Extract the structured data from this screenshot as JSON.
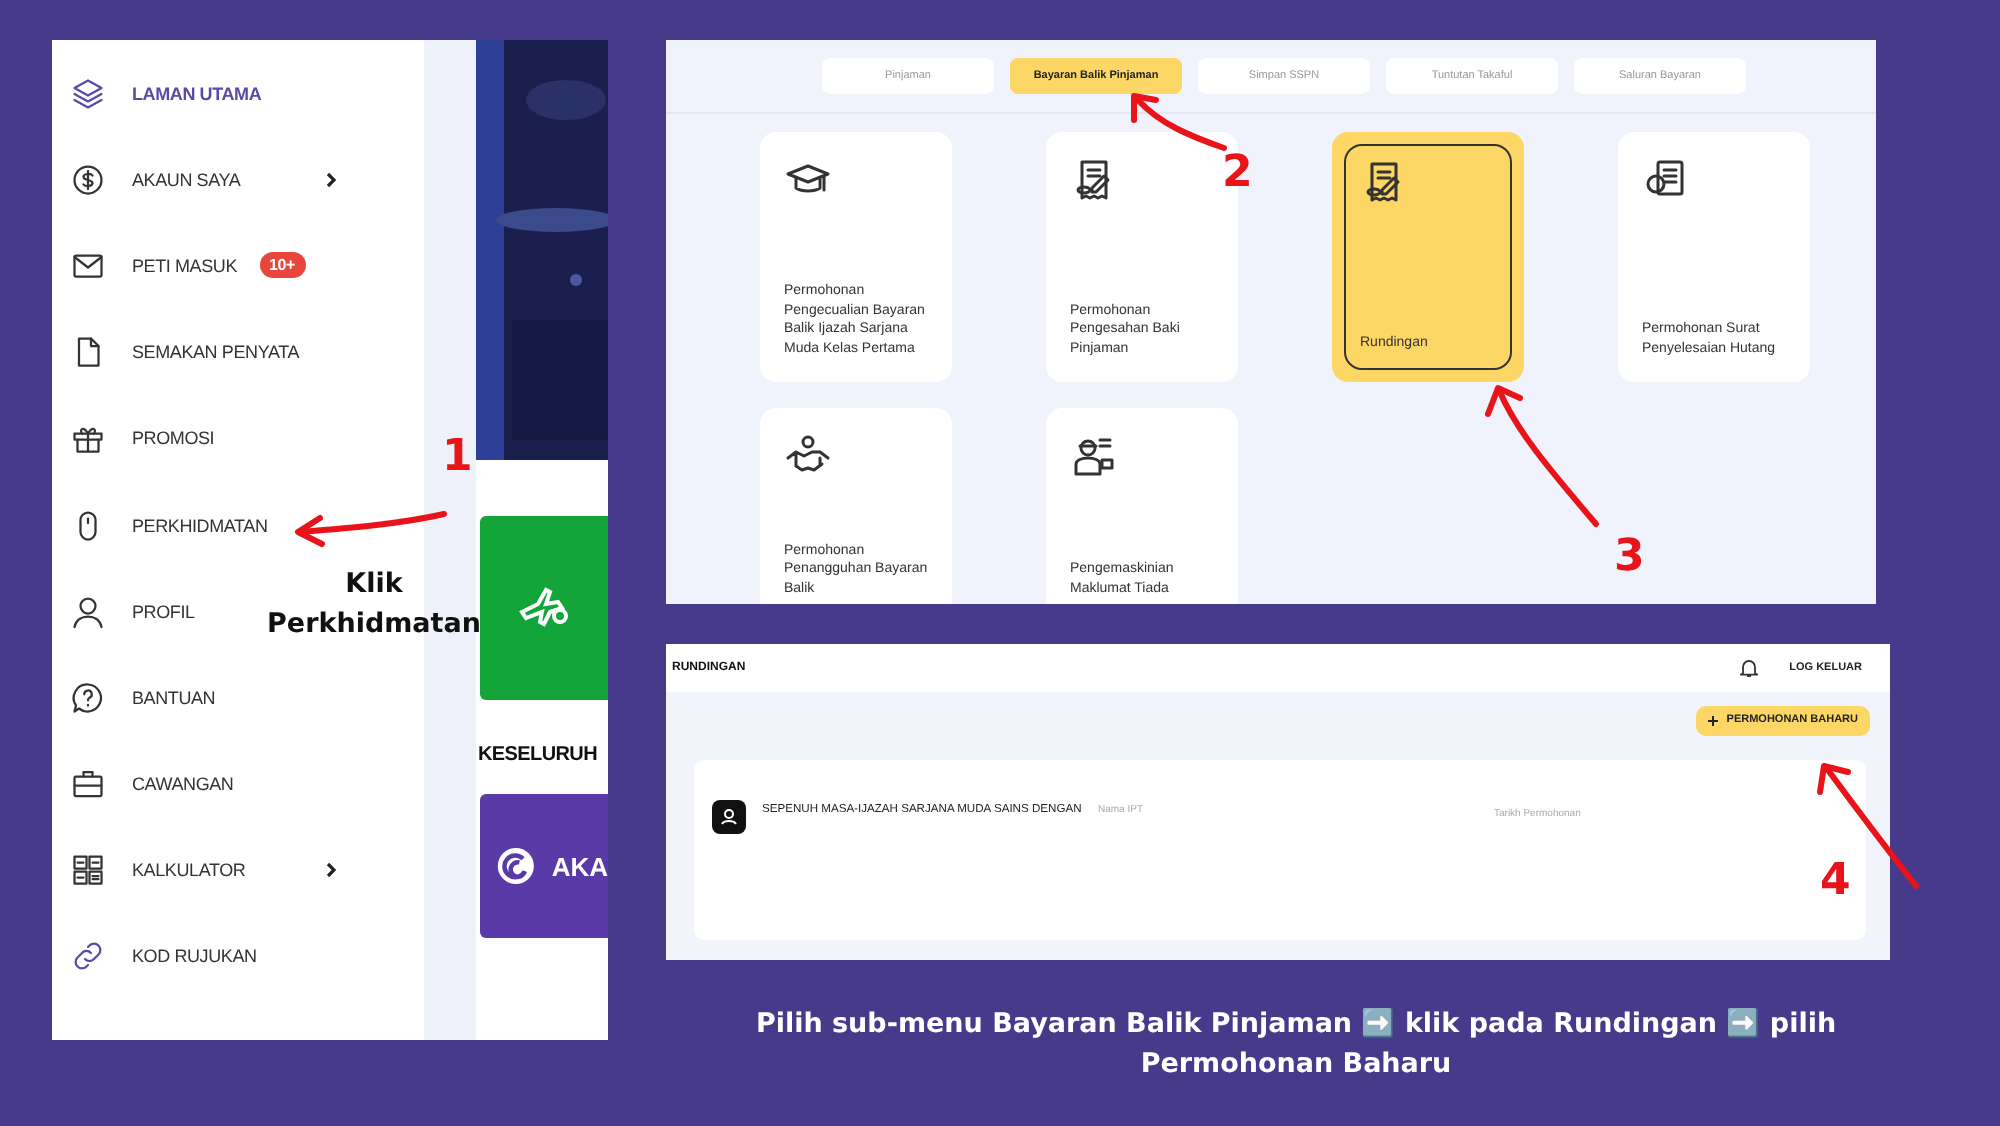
{
  "home_panel": {
    "sidebar": {
      "items": [
        {
          "label": "LAMAN UTAMA",
          "selected": true,
          "has_submenu": false
        },
        {
          "label": "AKAUN SAYA",
          "selected": false,
          "has_submenu": true
        },
        {
          "label": "PETI MASUK",
          "selected": false,
          "has_submenu": false,
          "badge": "10+"
        },
        {
          "label": "SEMAKAN PENYATA",
          "selected": false,
          "has_submenu": false
        },
        {
          "label": "PROMOSI",
          "selected": false,
          "has_submenu": false
        },
        {
          "label": "PERKHIDMATAN",
          "selected": false,
          "has_submenu": false
        },
        {
          "label": "PROFIL",
          "selected": false,
          "has_submenu": false
        },
        {
          "label": "BANTUAN",
          "selected": false,
          "has_submenu": false
        },
        {
          "label": "CAWANGAN",
          "selected": false,
          "has_submenu": false
        },
        {
          "label": "KALKULATOR",
          "selected": false,
          "has_submenu": true
        },
        {
          "label": "KOD RUJUKAN",
          "selected": false,
          "has_submenu": false
        }
      ]
    },
    "section_heading": "KESELURUH",
    "account_card": "AKA"
  },
  "services_panel": {
    "tabs": [
      {
        "label": "Pinjaman",
        "selected": false
      },
      {
        "label": "Bayaran Balik Pinjaman",
        "selected": true
      },
      {
        "label": "Simpan SSPN",
        "selected": false
      },
      {
        "label": "Tuntutan Takaful",
        "selected": false
      },
      {
        "label": "Saluran Bayaran",
        "selected": false
      }
    ],
    "cards": [
      {
        "label": "Permohonan Pengecualian Bayaran Balik Ijazah Sarjana Muda Kelas Pertama",
        "selected": false
      },
      {
        "label": "Permohonan Pengesahan Baki Pinjaman",
        "selected": false
      },
      {
        "label": "Rundingan",
        "selected": true
      },
      {
        "label": "Permohonan Surat Penyelesaian Hutang",
        "selected": false
      },
      {
        "label": "Permohonan Penangguhan Bayaran Balik",
        "selected": false
      },
      {
        "label": "Pengemaskinian Maklumat Tiada",
        "selected": false
      }
    ]
  },
  "rundingan_panel": {
    "title": "RUNDINGAN",
    "logout": "LOG KELUAR",
    "new_button": "PERMOHONAN BAHARU",
    "record": {
      "title": "SEPENUH MASA-IJAZAH SARJANA MUDA SAINS DENGAN",
      "institution_label": "Nama IPT",
      "date_label": "Tarikh Permohonan"
    }
  },
  "annotations": [
    {
      "number": "1"
    },
    {
      "number": "2"
    },
    {
      "number": "3"
    },
    {
      "number": "4"
    }
  ],
  "callout": "Klik Perkhidmatan",
  "caption": "Pilih sub-menu Bayaran Balik Pinjaman ➡️ klik pada Rundingan ➡️ pilih Permohonan Baharu"
}
